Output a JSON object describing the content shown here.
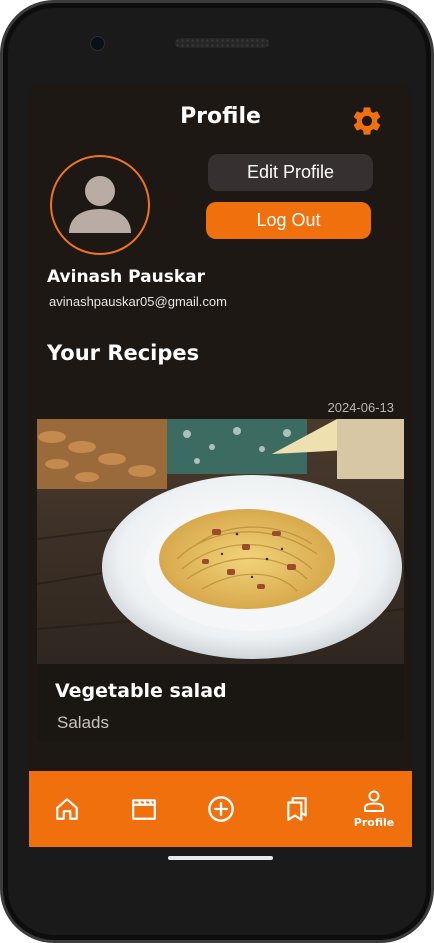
{
  "header": {
    "title": "Profile",
    "settings_icon": "gear-icon"
  },
  "profile": {
    "avatar_icon": "user-avatar-icon",
    "name": "Avinash Pauskar",
    "email": "avinashpauskar05@gmail.com",
    "edit_label": "Edit Profile",
    "logout_label": "Log Out"
  },
  "recipes": {
    "section_title": "Your Recipes",
    "items": [
      {
        "date": "2024-06-13",
        "name": "Vegetable salad",
        "category": "Salads",
        "image_icon": "pasta-plate-image"
      }
    ]
  },
  "bottom_nav": {
    "items": [
      {
        "icon": "home-icon",
        "label": ""
      },
      {
        "icon": "clapperboard-icon",
        "label": ""
      },
      {
        "icon": "add-circle-icon",
        "label": ""
      },
      {
        "icon": "bookmarks-icon",
        "label": ""
      },
      {
        "icon": "person-icon",
        "label": "Profile"
      }
    ],
    "active_index": 4
  },
  "colors": {
    "accent": "#f0700e",
    "background": "#1d1814",
    "secondary_button": "#363030"
  }
}
